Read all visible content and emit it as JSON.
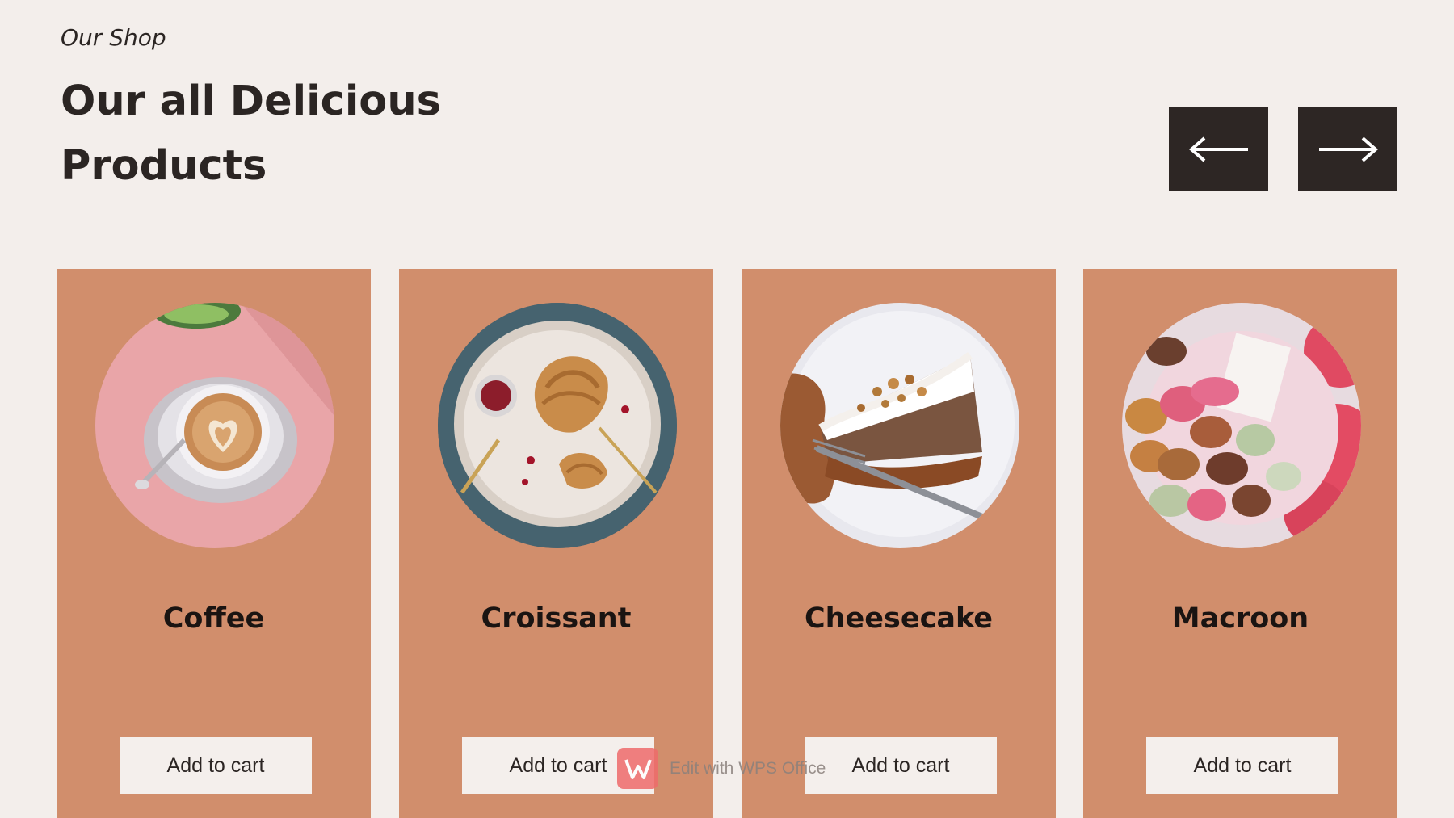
{
  "header": {
    "eyebrow": "Our Shop",
    "title_line1": "Our all Delicious",
    "title_line2": "Products"
  },
  "navigation": {
    "prev_icon": "arrow-left-icon",
    "next_icon": "arrow-right-icon"
  },
  "products": [
    {
      "name": "Coffee",
      "cart_label": "Add to cart",
      "image": "coffee-latte-art"
    },
    {
      "name": "Croissant",
      "cart_label": "Add to cart",
      "image": "croissant-plate"
    },
    {
      "name": "Cheesecake",
      "cart_label": "Add to cart",
      "image": "cheesecake-slice"
    },
    {
      "name": "Macroon",
      "cart_label": "Add to cart",
      "image": "macarons-box"
    }
  ],
  "watermark": {
    "text": "Edit with WPS Office",
    "icon": "wps-logo-icon"
  },
  "colors": {
    "page_background": "#f3eeeb",
    "card_background": "#d18e6c",
    "nav_button": "#2d2624",
    "button_background": "#f4efec",
    "text_dark": "#2b2523"
  }
}
